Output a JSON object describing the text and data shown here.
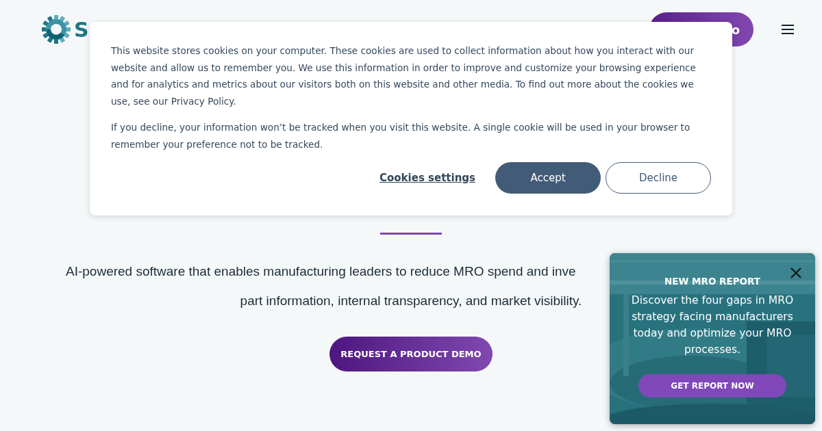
{
  "header": {
    "logo_text": "S",
    "cta": "o"
  },
  "hero": {
    "lines": [
      "AI-powered software that enables manufacturing leaders to reduce MRO spend and inve",
      "part information, internal transparency, and market visibility."
    ],
    "button": "REQUEST A PRODUCT DEMO"
  },
  "cookie_banner": {
    "paragraphs": [
      "This website stores cookies on your computer. These cookies are used to collect information about how you interact with our website and allow us to remember you. We use this information in order to improve and customize your browsing experience and for analytics and metrics about our visitors both on this website and other media. To find out more about the cookies we use, see our Privacy Policy.",
      "If you decline, your information won’t be tracked when you visit this website. A single cookie will be used in your browser to remember your preference not to be tracked."
    ],
    "buttons": [
      {
        "kind": "link",
        "label": "Cookies settings"
      },
      {
        "kind": "primary",
        "label": "Accept"
      },
      {
        "kind": "outline",
        "label": "Decline"
      }
    ]
  },
  "promo": {
    "title": "NEW MRO REPORT",
    "body": "Discover the four gaps in MRO strategy facing manufacturers today and optimize your MRO processes.",
    "button": "GET REPORT NOW"
  }
}
